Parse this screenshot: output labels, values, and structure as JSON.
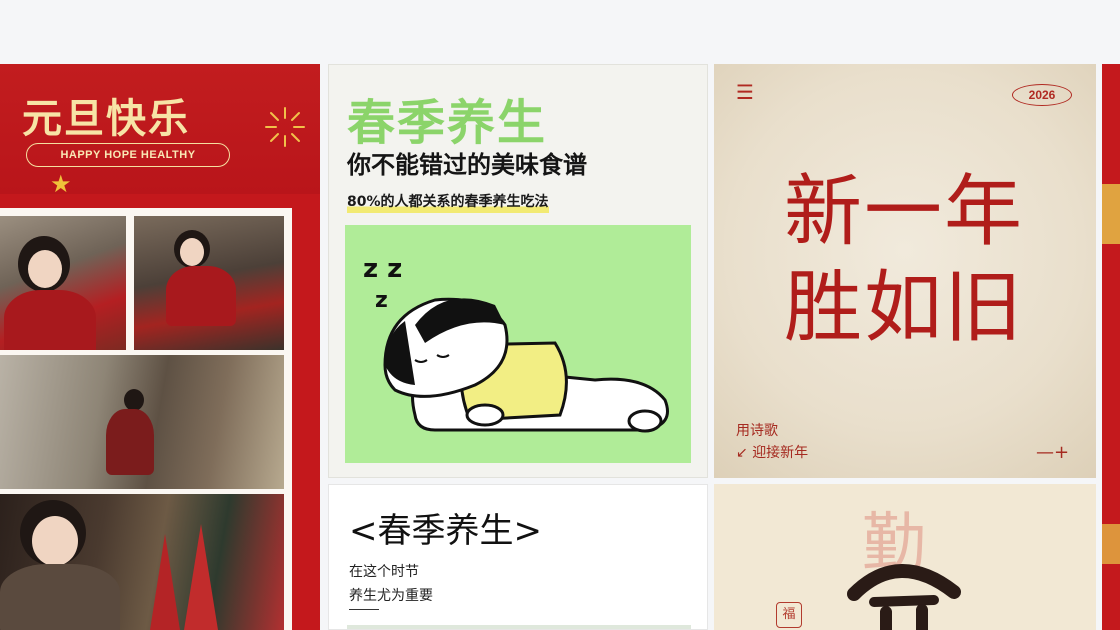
{
  "cards": {
    "new_year": {
      "title": "元旦快乐",
      "subtitle": "HAPPY HOPE HEALTHY"
    },
    "spring_recipe": {
      "title": "春季养生",
      "subtitle": "你不能错过的美味食谱",
      "note": "80%的人都关系的春季养生吃法"
    },
    "lyric_new_year": {
      "year_badge": "2026",
      "calligraphy_line1": "新一年",
      "calligraphy_line2": "胜如旧",
      "footer_line1": "用诗歌",
      "footer_line2": "迎接新年",
      "menu_icon": "menu-icon"
    },
    "spring_text": {
      "title": "<春季养生>",
      "line1": "在这个时节",
      "line2": "养生尤为重要"
    },
    "diligence": {
      "ghost_char": "勤",
      "seal_char": "福"
    }
  },
  "colors": {
    "festive_red": "#c4181c",
    "gold": "#f7e4a6",
    "spring_green": "#8bd46a",
    "illustration_bg": "#b0ec98",
    "paper": "#eae0cd",
    "ink_red": "#b01d1a"
  }
}
